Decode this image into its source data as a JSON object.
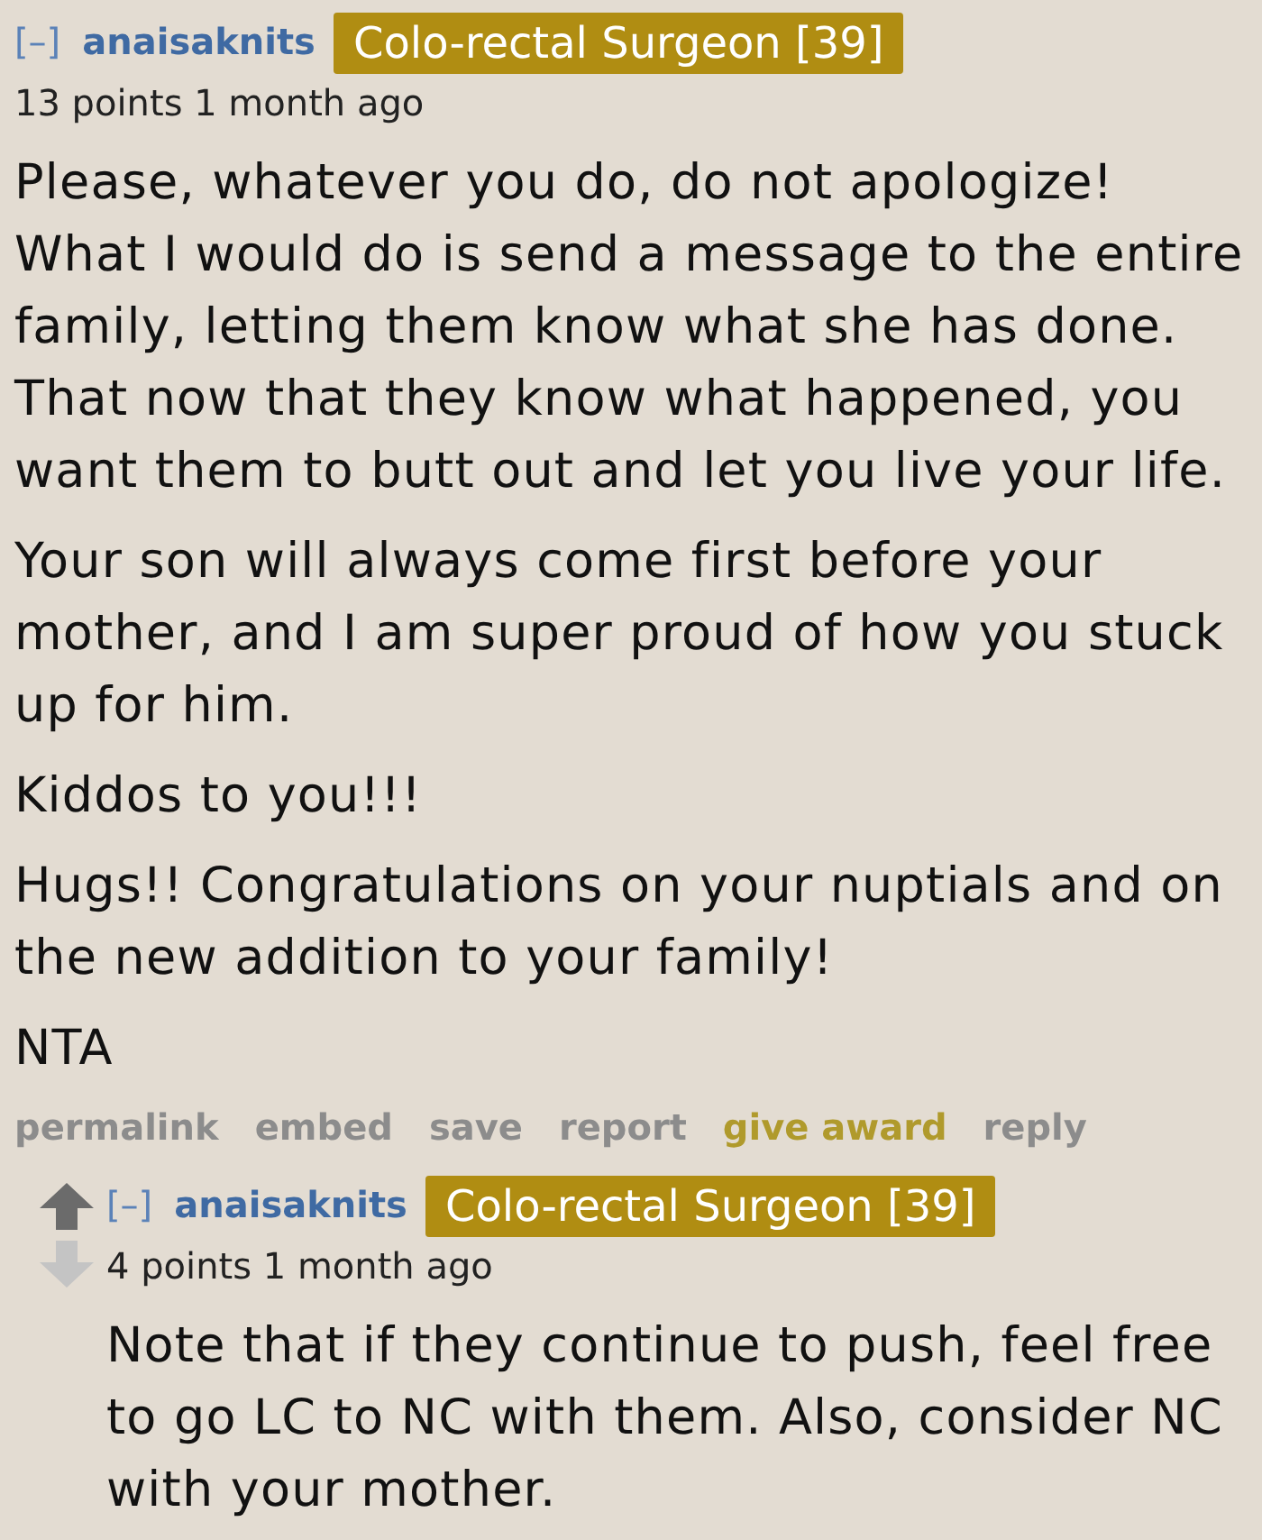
{
  "comments": [
    {
      "collapse": "[–]",
      "author": "anaisaknits",
      "flair": "Colo-rectal Surgeon [39]",
      "meta": "13 points 1 month ago",
      "paragraphs": [
        "Please, whatever you do, do not apologize! What I would do is send a message to the entire family, letting them know what she has done. That now that they know what happened, you want them to butt out and let you live your life.",
        "Your son will always come first before your mother, and I am super proud of how you stuck up for him.",
        "Kiddos to you!!!",
        "Hugs!! Congratulations on your nuptials and on the new addition to your family!",
        "NTA"
      ],
      "actions": [
        {
          "label": "permalink",
          "kind": "link"
        },
        {
          "label": "embed",
          "kind": "link"
        },
        {
          "label": "save",
          "kind": "link"
        },
        {
          "label": "report",
          "kind": "link"
        },
        {
          "label": "give award",
          "kind": "award"
        },
        {
          "label": "reply",
          "kind": "link"
        }
      ],
      "replies": [
        {
          "collapse": "[–]",
          "author": "anaisaknits",
          "flair": "Colo-rectal Surgeon [39]",
          "meta": "4 points 1 month ago",
          "paragraphs": [
            "Note that if they continue to push, feel free to go LC to NC with them. Also, consider NC with your mother."
          ]
        }
      ]
    }
  ]
}
